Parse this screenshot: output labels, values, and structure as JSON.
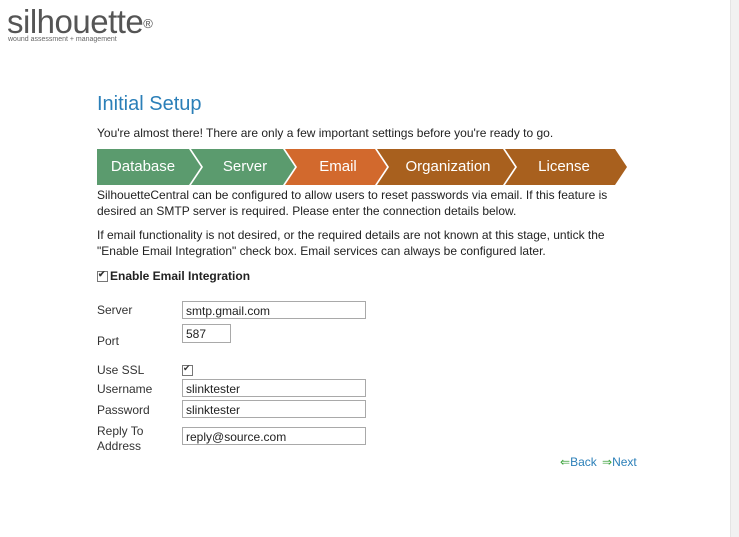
{
  "logo": {
    "name": "silhouette",
    "reg": "®",
    "tagline": "wound assessment + management"
  },
  "page": {
    "title": "Initial Setup",
    "intro": "You're almost there! There are only a few important settings before you're ready to go."
  },
  "wizard": {
    "steps": [
      {
        "label": "Database",
        "state": "complete",
        "color": "#5b9b6e"
      },
      {
        "label": "Server",
        "state": "complete",
        "color": "#5b9b6e"
      },
      {
        "label": "Email",
        "state": "current",
        "color": "#d2692d"
      },
      {
        "label": "Organization",
        "state": "pending",
        "color": "#a8601e"
      },
      {
        "label": "License",
        "state": "pending",
        "color": "#a8601e"
      }
    ]
  },
  "description": {
    "p1": "SilhouetteCentral can be configured to allow users to reset passwords via email. If this feature is desired an SMTP server is required. Please enter the connection details below.",
    "p2": "If email functionality is not desired, or the required details are not known at this stage, untick the \"Enable Email Integration\" check box. Email services can always be configured later."
  },
  "enable_email": {
    "label": "Enable Email Integration",
    "checked": true
  },
  "form": {
    "server": {
      "label": "Server",
      "value": "smtp.gmail.com"
    },
    "port": {
      "label": "Port",
      "value": "587"
    },
    "use_ssl": {
      "label": "Use SSL",
      "checked": true
    },
    "username": {
      "label": "Username",
      "value": "slinktester"
    },
    "password": {
      "label": "Password",
      "value": "slinktester"
    },
    "reply_to": {
      "label_line1": "Reply To",
      "label_line2": "Address",
      "value": "reply@source.com"
    }
  },
  "nav": {
    "back": {
      "label": "Back",
      "icon": "arrow-left-icon"
    },
    "next": {
      "label": "Next",
      "icon": "arrow-right-icon"
    }
  },
  "colors": {
    "accent": "#2b7fb8",
    "arrow": "#3ca23c"
  }
}
